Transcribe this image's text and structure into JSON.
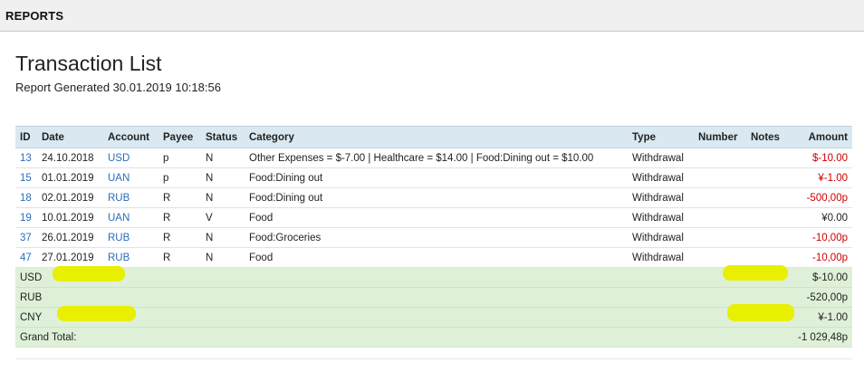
{
  "header": {
    "title": "REPORTS"
  },
  "report": {
    "title": "Transaction List",
    "generated": "Report Generated 30.01.2019 10:18:56"
  },
  "table": {
    "columns": [
      "ID",
      "Date",
      "Account",
      "Payee",
      "Status",
      "Category",
      "Type",
      "Number",
      "Notes",
      "Amount"
    ],
    "rows": [
      {
        "id": "13",
        "date": "24.10.2018",
        "account": "USD",
        "payee": "p",
        "status": "N",
        "category": "Other Expenses = $-7.00 | Healthcare = $14.00 | Food:Dining out = $10.00",
        "type": "Withdrawal",
        "number": "",
        "notes": "",
        "amount": "$-10.00",
        "negative": true
      },
      {
        "id": "15",
        "date": "01.01.2019",
        "account": "UAN",
        "payee": "p",
        "status": "N",
        "category": "Food:Dining out",
        "type": "Withdrawal",
        "number": "",
        "notes": "",
        "amount": "¥-1.00",
        "negative": true
      },
      {
        "id": "18",
        "date": "02.01.2019",
        "account": "RUB",
        "payee": "R",
        "status": "N",
        "category": "Food:Dining out",
        "type": "Withdrawal",
        "number": "",
        "notes": "",
        "amount": "-500,00р",
        "negative": true
      },
      {
        "id": "19",
        "date": "10.01.2019",
        "account": "UAN",
        "payee": "R",
        "status": "V",
        "category": "Food",
        "type": "Withdrawal",
        "number": "",
        "notes": "",
        "amount": "¥0.00",
        "negative": false
      },
      {
        "id": "37",
        "date": "26.01.2019",
        "account": "RUB",
        "payee": "R",
        "status": "N",
        "category": "Food:Groceries",
        "type": "Withdrawal",
        "number": "",
        "notes": "",
        "amount": "-10,00р",
        "negative": true
      },
      {
        "id": "47",
        "date": "27.01.2019",
        "account": "RUB",
        "payee": "R",
        "status": "N",
        "category": "Food",
        "type": "Withdrawal",
        "number": "",
        "notes": "",
        "amount": "-10,00р",
        "negative": true
      }
    ],
    "totals": [
      {
        "label": "USD",
        "amount": "$-10.00"
      },
      {
        "label": "RUB",
        "amount": "-520,00р"
      },
      {
        "label": "CNY",
        "amount": "¥-1.00"
      },
      {
        "label": "Grand Total:",
        "amount": "-1 029,48р"
      }
    ]
  },
  "colors": {
    "header_bg": "#dae9f1",
    "totals_bg": "#dff0d8",
    "link": "#2a6ebb",
    "negative": "#cc0000",
    "highlight": "#e8ef00"
  }
}
